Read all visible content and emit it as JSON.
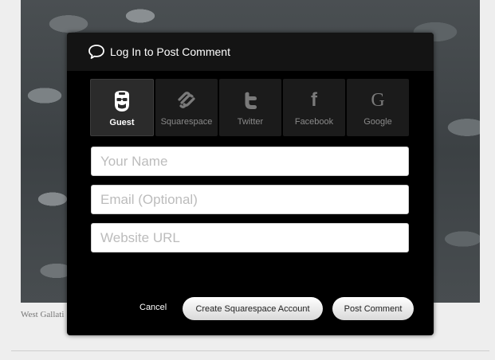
{
  "background": {
    "caption": "West Gallati"
  },
  "modal": {
    "title": "Log In to Post Comment",
    "tabs": [
      {
        "label": "Guest",
        "icon": "guest-avatar-icon",
        "active": true
      },
      {
        "label": "Squarespace",
        "icon": "squarespace-icon",
        "active": false
      },
      {
        "label": "Twitter",
        "icon": "twitter-icon",
        "active": false
      },
      {
        "label": "Facebook",
        "icon": "facebook-icon",
        "active": false
      },
      {
        "label": "Google",
        "icon": "google-icon",
        "active": false
      }
    ],
    "fields": {
      "name": {
        "value": "",
        "placeholder": "Your Name"
      },
      "email": {
        "value": "",
        "placeholder": "Email (Optional)"
      },
      "website": {
        "value": "",
        "placeholder": "Website URL"
      }
    },
    "actions": {
      "cancel": "Cancel",
      "create_account": "Create Squarespace Account",
      "post": "Post Comment"
    }
  },
  "colors": {
    "modal_bg": "#000000",
    "header_bg": "#141414",
    "tab_bg": "#1b1b1b",
    "tab_active_bg": "#2b2b2b"
  }
}
